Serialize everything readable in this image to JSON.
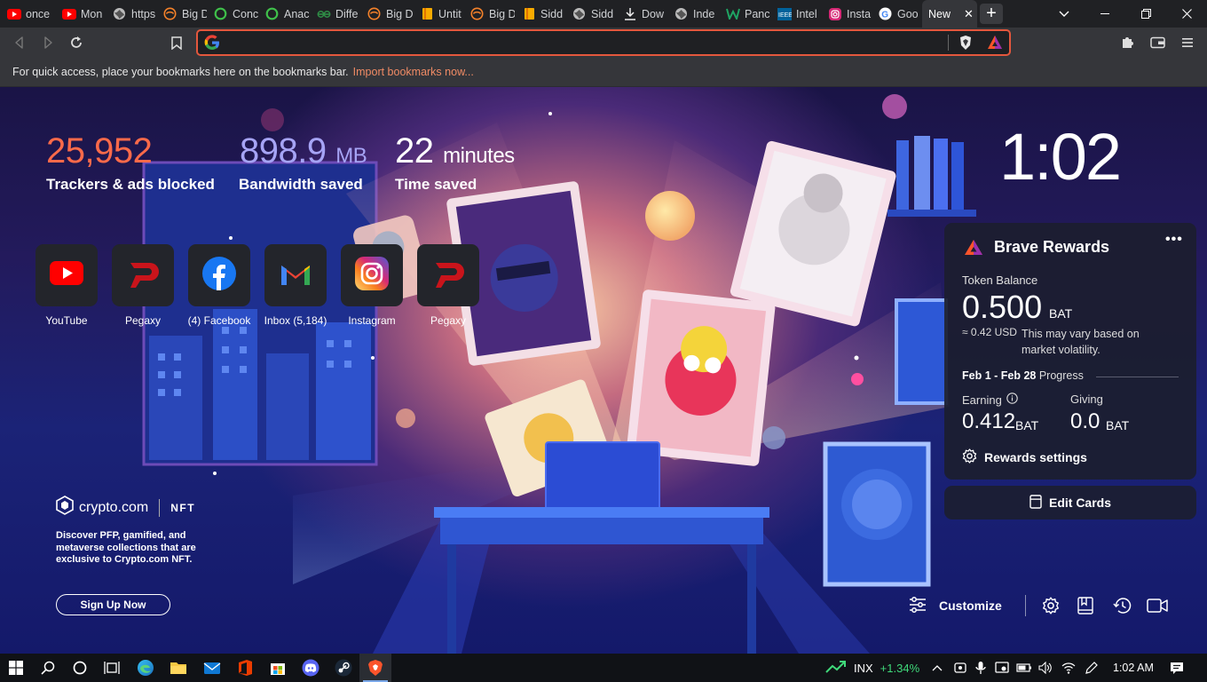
{
  "tabs": [
    {
      "label": "once",
      "icon": "youtube-icon"
    },
    {
      "label": "Mon",
      "icon": "youtube-icon"
    },
    {
      "label": "https",
      "icon": "globe-icon"
    },
    {
      "label": "Big D",
      "icon": "big-data-icon"
    },
    {
      "label": "Conc",
      "icon": "ring-icon"
    },
    {
      "label": "Anac",
      "icon": "ring-icon"
    },
    {
      "label": "Diffe",
      "icon": "geeks-icon"
    },
    {
      "label": "Big D",
      "icon": "big-data-icon"
    },
    {
      "label": "Untit",
      "icon": "notebook-icon"
    },
    {
      "label": "Big D",
      "icon": "big-data-icon"
    },
    {
      "label": "Sidd",
      "icon": "notebook-icon"
    },
    {
      "label": "Sidd",
      "icon": "globe-icon"
    },
    {
      "label": "Dow",
      "icon": "download-icon"
    },
    {
      "label": "Inde",
      "icon": "globe-icon"
    },
    {
      "label": "Panc",
      "icon": "w-icon"
    },
    {
      "label": "Intel",
      "icon": "ieee-icon"
    },
    {
      "label": "Insta",
      "icon": "instagram-icon"
    },
    {
      "label": "Goo",
      "icon": "google-icon"
    },
    {
      "label": "New",
      "icon": "none"
    }
  ],
  "toolbar": {
    "address_value": ""
  },
  "bookmarks_bar": {
    "text": "For quick access, place your bookmarks here on the bookmarks bar.",
    "link": "Import bookmarks now..."
  },
  "stats": {
    "trackers": {
      "value": "25,952",
      "label": "Trackers & ads blocked"
    },
    "bandwidth": {
      "value": "898.9",
      "unit": "MB",
      "label": "Bandwidth saved"
    },
    "time": {
      "value": "22",
      "unit": "minutes",
      "label": "Time saved"
    }
  },
  "clock": "1:02",
  "top_sites": [
    {
      "label": "YouTube",
      "icon": "youtube-icon"
    },
    {
      "label": "Pegaxy",
      "icon": "pegaxy-icon"
    },
    {
      "label": "(4) Facebook",
      "icon": "facebook-icon"
    },
    {
      "label": "Inbox (5,184)",
      "icon": "gmail-icon"
    },
    {
      "label": "Instagram",
      "icon": "instagram-icon"
    },
    {
      "label": "Pegaxy",
      "icon": "pegaxy-icon"
    }
  ],
  "rewards": {
    "title": "Brave Rewards",
    "balance_label": "Token Balance",
    "balance": "0.500",
    "balance_unit": "BAT",
    "usd": "≈ 0.42 USD",
    "note": "This may vary based on market volatility.",
    "period": "Feb 1 - Feb 28",
    "progress_label": "Progress",
    "earning_label": "Earning",
    "earning_value": "0.412",
    "earning_unit": "BAT",
    "giving_label": "Giving",
    "giving_value": "0.0",
    "giving_unit": "BAT",
    "settings": "Rewards settings"
  },
  "edit_cards": "Edit Cards",
  "crypto": {
    "brand": "crypto.com",
    "tag": "NFT",
    "description": "Discover PFP, gamified, and metaverse collections that are exclusive to Crypto.com NFT.",
    "cta": "Sign Up Now"
  },
  "customize_label": "Customize",
  "taskbar": {
    "ticker": "INX",
    "change": "+1.34%",
    "time": "1:02 AM"
  },
  "colors": {
    "brave_orange": "#fb542b",
    "trackers": "#fb6a4a",
    "bandwidth": "#a6a4f5",
    "ticker_green": "#3fd97a"
  }
}
